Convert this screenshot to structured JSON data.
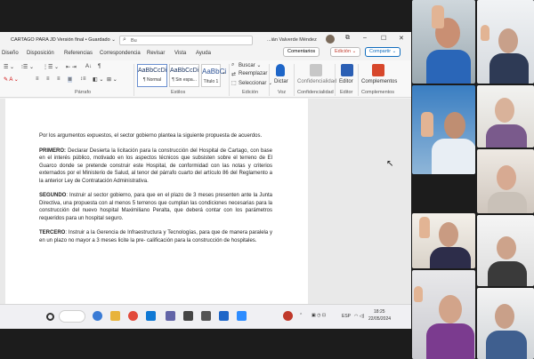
{
  "titlebar": {
    "filename": "CARTAGO PARA JD Versión final • Guardado ⌄",
    "search_placeholder": "Bu",
    "user": "...ián Valverde Méndez"
  },
  "menu": {
    "items": [
      "Diseño",
      "Disposición",
      "Referencias",
      "Correspondencia",
      "Revisar",
      "Vista",
      "Ayuda"
    ],
    "comments": "Comentarios",
    "editing": "Edición ⌄",
    "share": "Compartir ⌄"
  },
  "ribbon": {
    "paragraph_label": "Párrafo",
    "styles_label": "Estilos",
    "editing_label": "Edición",
    "voice_label": "Voz",
    "confidential_label": "Confidencialidad",
    "editor_label": "Editor",
    "addins_label": "Complementos",
    "style_normal_sample": "AaBbCcDi",
    "style_normal_name": "¶ Normal",
    "style_nospace_sample": "AaBbCcDi",
    "style_nospace_name": "¶ Sin espa...",
    "style_title_sample": "AaBbCi",
    "style_title_name": "Título 1",
    "find": "Buscar ⌄",
    "replace": "Reemplazar",
    "select": "Seleccionar ⌄",
    "dictate": "Dictar",
    "confidential": "Confidencialidad",
    "editor": "Editor",
    "addins": "Complementos"
  },
  "document": {
    "intro": "Por los argumentos expuestos, el sector gobierno plantea la siguiente propuesta de acuerdos.",
    "p1_head": "PRIMERO:",
    "p1_body": " Declarar Desierta la licitación para la construcción del Hospital de Cartago, con base en el interés público, motivado en los aspectos técnicos que subsisten sobre el terreno de El Guarco donde se pretende construir este Hospital, de conformidad con las notas y criterios externados por el Ministerio de Salud, al tenor del párrafo cuarto del artículo 86 del Reglamento a la anterior Ley de Contratación Administrativa.",
    "p2_head": "SEGUNDO",
    "p2_body": ": Instruir al sector gobierno, para que en el plazo de 3 meses presenten ante la Junta Directiva, una propuesta con al menos 5 terrenos que cumplan las condiciones necesarias para la construcción del nuevo hospital Maximiliano Peralta, que deberá contar con los parámetros requeridos para un hospital seguro.",
    "p3_head": "TERCERO",
    "p3_body": ": Instruir a la Gerencia de Infraestructura y Tecnologías, para que de manera paralela y en un plazo no mayor a 3 meses licite la pre- calificación para la construcción de hospitales."
  },
  "taskbar": {
    "lang": "ESP",
    "time": "18:25",
    "date": "22/05/2024"
  },
  "colors": {
    "accent": "#0f6cbd",
    "word_blue": "#185abd"
  }
}
